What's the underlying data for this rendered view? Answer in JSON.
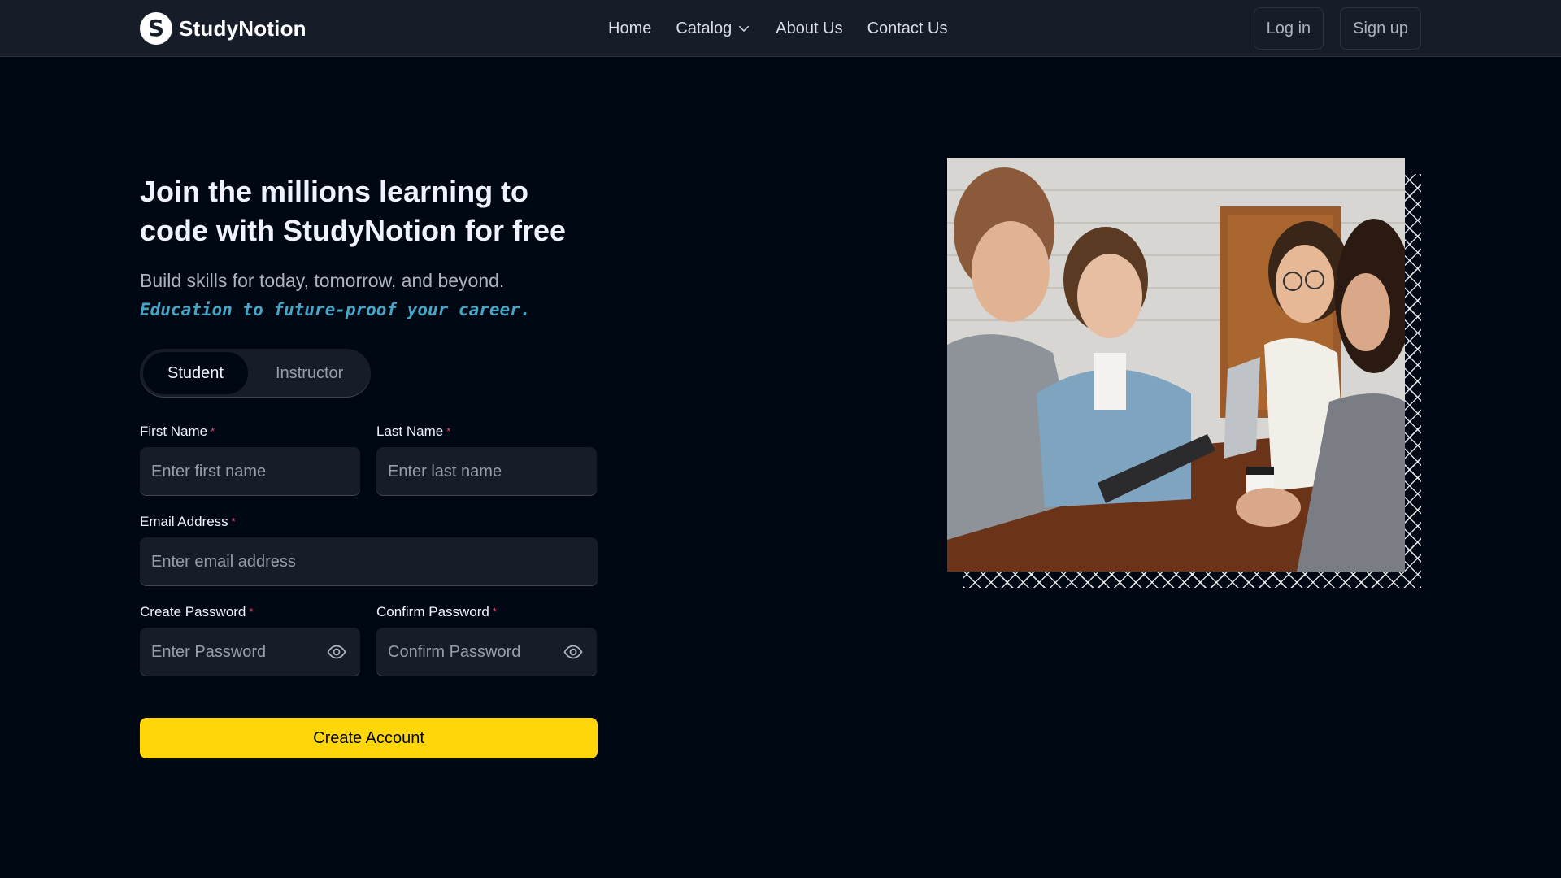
{
  "brand": {
    "logo_letter": "S",
    "name": "StudyNotion"
  },
  "nav": {
    "links": [
      "Home",
      "Catalog",
      "About Us",
      "Contact Us"
    ],
    "login_label": "Log in",
    "signup_label": "Sign up"
  },
  "hero": {
    "heading": "Join the millions learning to code with StudyNotion for free",
    "subtext": "Build skills for today, tomorrow, and beyond.",
    "highlight": "Education to future-proof your career."
  },
  "roles": {
    "student": "Student",
    "instructor": "Instructor",
    "selected": "Student"
  },
  "form": {
    "first_name": {
      "label": "First Name",
      "placeholder": "Enter first name"
    },
    "last_name": {
      "label": "Last Name",
      "placeholder": "Enter last name"
    },
    "email": {
      "label": "Email Address",
      "placeholder": "Enter email address"
    },
    "create_password": {
      "label": "Create Password",
      "placeholder": "Enter Password"
    },
    "confirm_password": {
      "label": "Confirm Password",
      "placeholder": "Confirm Password"
    },
    "required_mark": "*",
    "submit_label": "Create Account"
  },
  "colors": {
    "background": "#000814",
    "navbar": "#161d29",
    "accent_yellow": "#ffd60a",
    "highlight_blue": "#47a5c5",
    "required_pink": "#ef476f"
  },
  "icons": {
    "catalog_dropdown": "chevron-down-icon",
    "password_visibility": "eye-icon"
  }
}
